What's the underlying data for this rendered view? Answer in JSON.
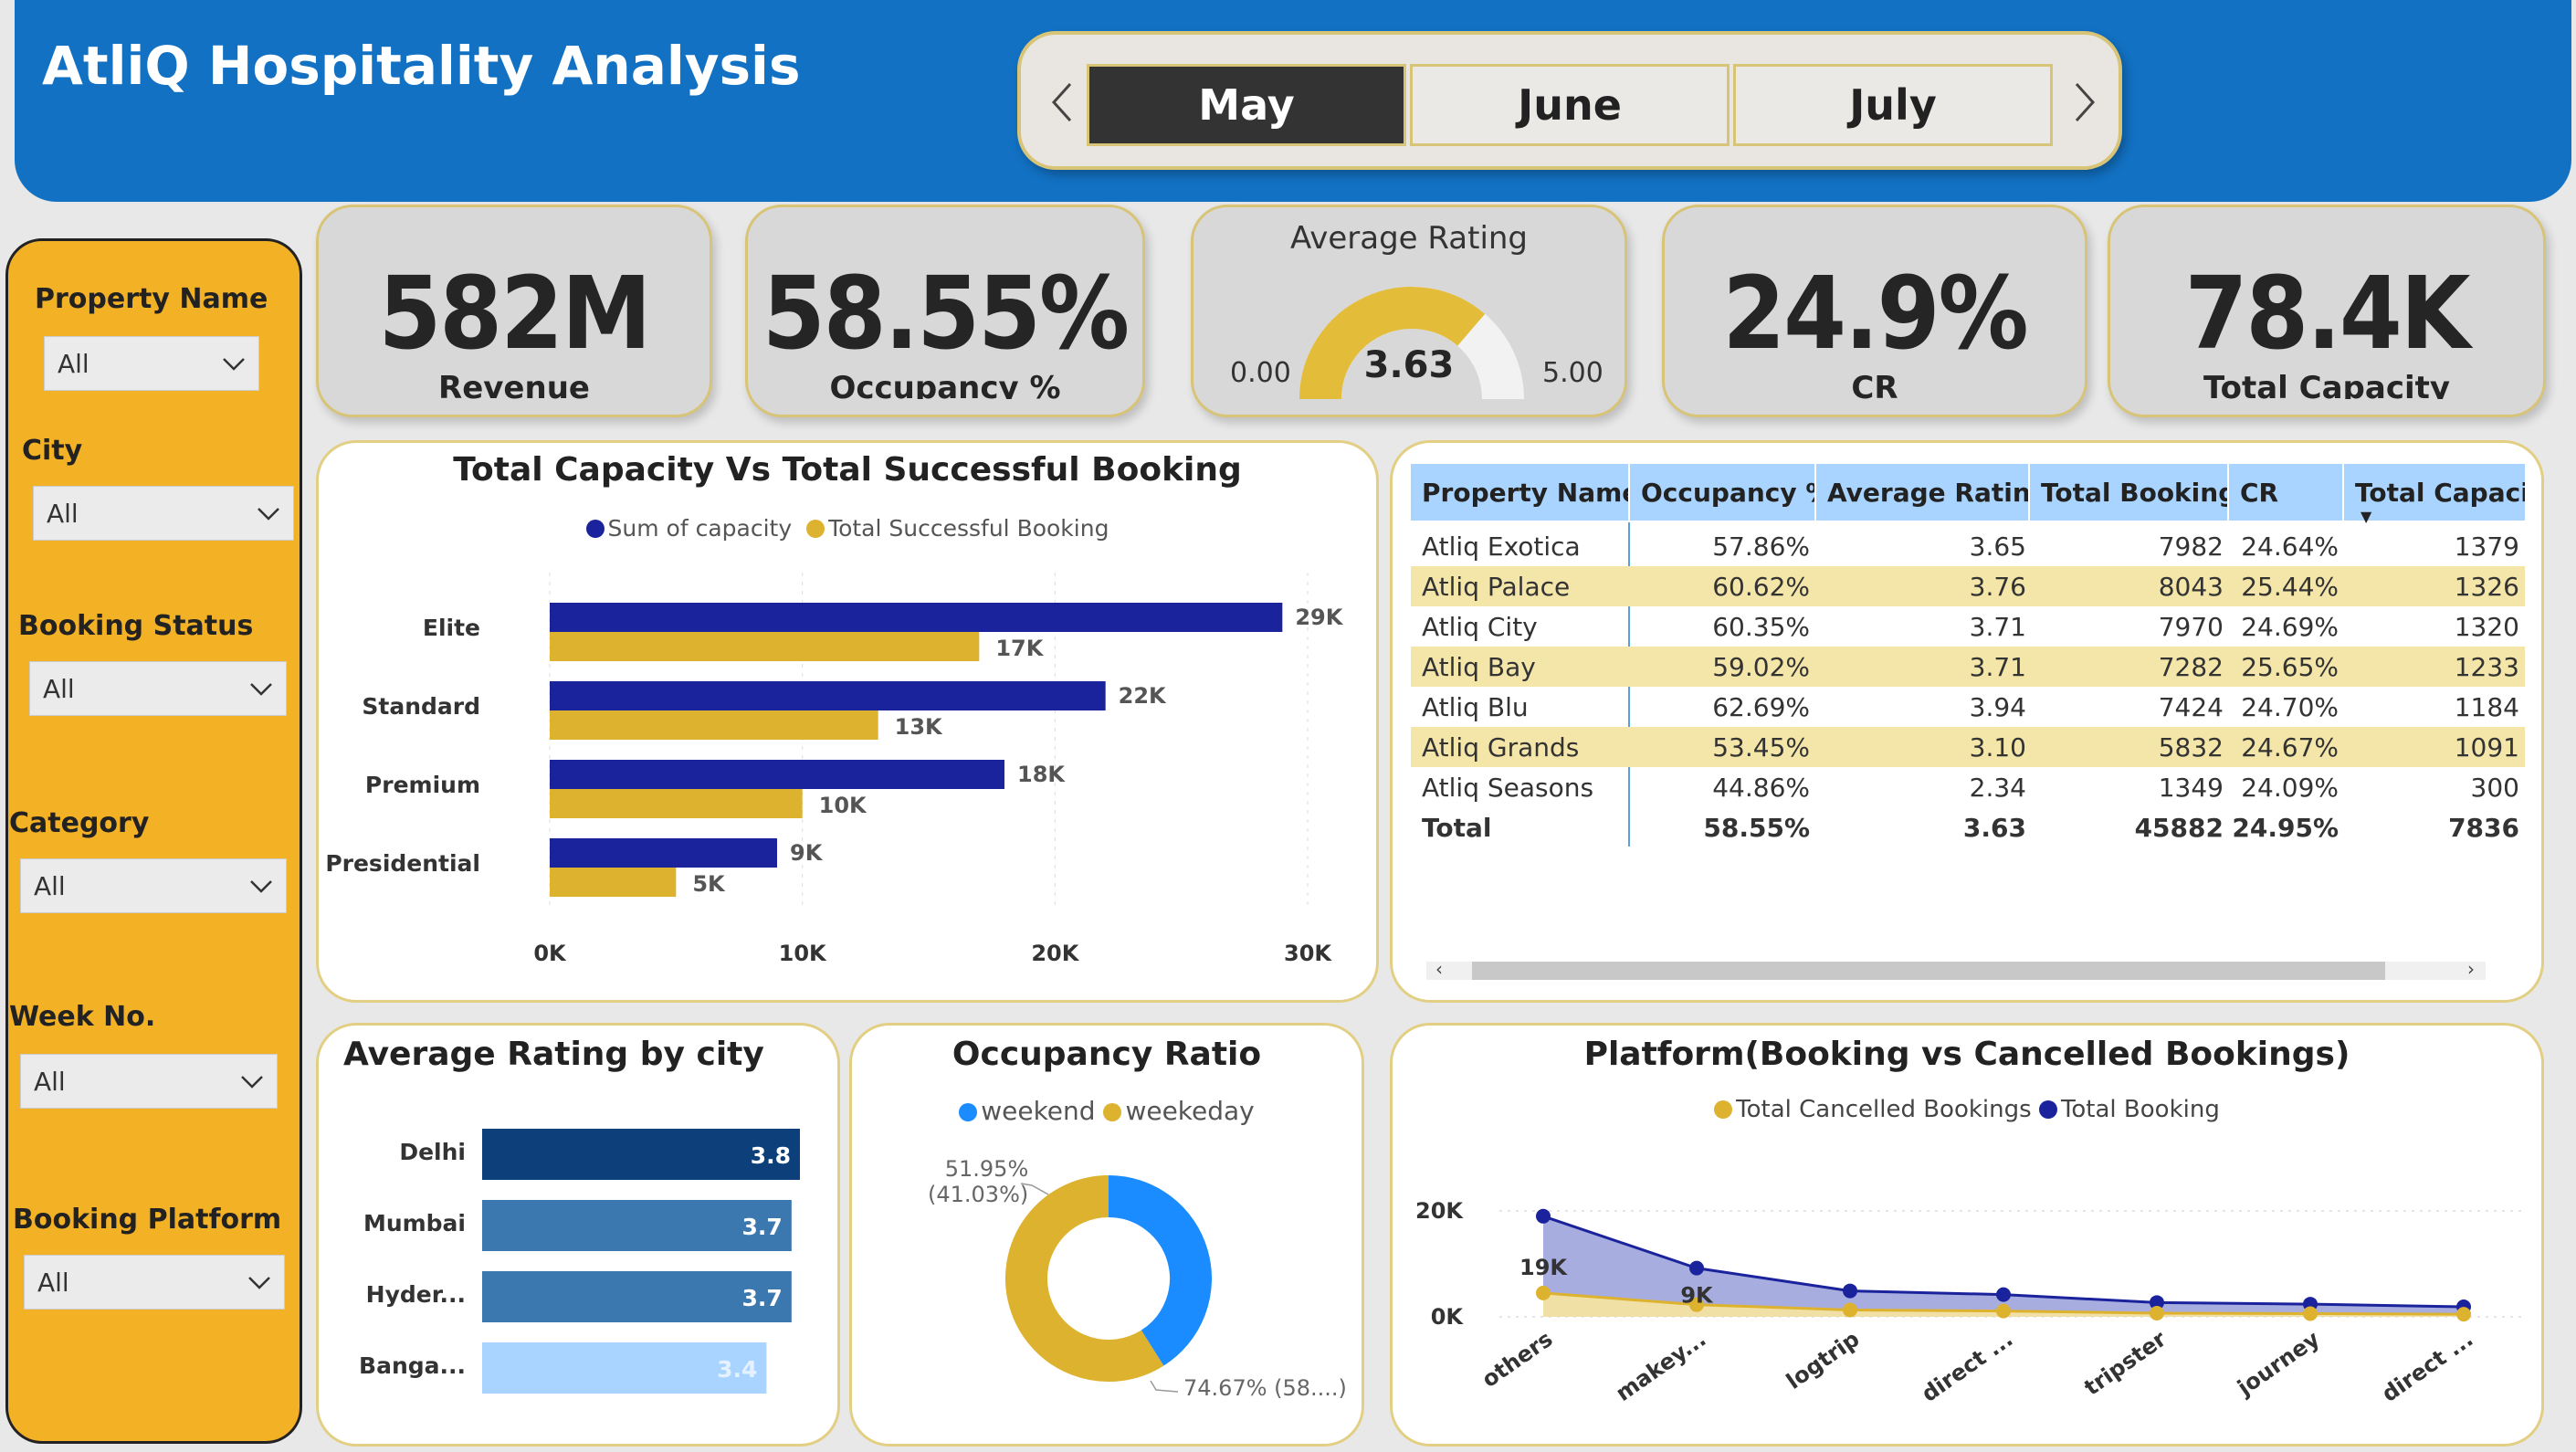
{
  "header": {
    "title": "AtliQ Hospitality Analysis",
    "months": [
      "May",
      "June",
      "July"
    ],
    "active_month": "May"
  },
  "filters": [
    {
      "label": "Property Name",
      "value": "All"
    },
    {
      "label": "City",
      "value": "All"
    },
    {
      "label": "Booking Status",
      "value": "All"
    },
    {
      "label": "Category",
      "value": "All"
    },
    {
      "label": "Week No.",
      "value": "All"
    },
    {
      "label": "Booking Platform",
      "value": "All"
    }
  ],
  "kpis": {
    "revenue": {
      "value": "582M",
      "label": "Revenue"
    },
    "occupancy": {
      "value": "58.55%",
      "label": "Occupancy %"
    },
    "rating": {
      "title": "Average Rating",
      "value": "3.63",
      "min": "0.00",
      "max": "5.00",
      "fraction": 0.726
    },
    "cr": {
      "value": "24.9%",
      "label": "CR"
    },
    "capacity": {
      "value": "78.4K",
      "label": "Total Capacity"
    }
  },
  "colors": {
    "accent_blue": "#1271c3",
    "navy": "#1a239c",
    "gold": "#ddb22e",
    "sidebar": "#f3b126",
    "table_header": "#a9d4ff",
    "table_alt": "#f4e6a9",
    "donut_blue": "#1a8cff"
  },
  "capacity_chart": {
    "title": "Total Capacity Vs Total Successful Booking",
    "legend": [
      "Sum of capacity",
      "Total Successful Booking"
    ],
    "x_ticks": [
      "0K",
      "10K",
      "20K",
      "30K"
    ]
  },
  "table": {
    "headers": [
      "Property Name",
      "Occupancy %",
      "Average Rating",
      "Total Booking",
      "CR",
      "Total Capacit"
    ],
    "rows": [
      [
        "Atliq Exotica",
        "57.86%",
        "3.65",
        "7982",
        "24.64%",
        "1379"
      ],
      [
        "Atliq Palace",
        "60.62%",
        "3.76",
        "8043",
        "25.44%",
        "1326"
      ],
      [
        "Atliq City",
        "60.35%",
        "3.71",
        "7970",
        "24.69%",
        "1320"
      ],
      [
        "Atliq Bay",
        "59.02%",
        "3.71",
        "7282",
        "25.65%",
        "1233"
      ],
      [
        "Atliq Blu",
        "62.69%",
        "3.94",
        "7424",
        "24.70%",
        "1184"
      ],
      [
        "Atliq Grands",
        "53.45%",
        "3.10",
        "5832",
        "24.67%",
        "1091"
      ],
      [
        "Atliq Seasons",
        "44.86%",
        "2.34",
        "1349",
        "24.09%",
        "300"
      ]
    ],
    "total": [
      "Total",
      "58.55%",
      "3.63",
      "45882",
      "24.95%",
      "7836"
    ]
  },
  "rating_chart": {
    "title": "Average Rating by city"
  },
  "occupancy_chart": {
    "title": "Occupancy Ratio",
    "legend": [
      "weekend",
      "weekeday"
    ],
    "label_weekend_a": "51.95%",
    "label_weekend_b": "(41.03%)",
    "label_weekday": "74.67% (58....)"
  },
  "platform_chart": {
    "title": "Platform(Booking vs Cancelled Bookings)",
    "legend": [
      "Total Cancelled Bookings",
      "Total Booking"
    ],
    "y_ticks": [
      "20K",
      "0K"
    ]
  },
  "chart_data": [
    {
      "type": "bar",
      "orientation": "horizontal",
      "title": "Total Capacity Vs Total Successful Booking",
      "categories": [
        "Elite",
        "Standard",
        "Premium",
        "Presidential"
      ],
      "series": [
        {
          "name": "Sum of capacity",
          "values": [
            29,
            22,
            18,
            9
          ],
          "labels": [
            "29K",
            "22K",
            "18K",
            "9K"
          ],
          "color": "#1a239c"
        },
        {
          "name": "Total Successful Booking",
          "values": [
            17,
            13,
            10,
            5
          ],
          "labels": [
            "17K",
            "13K",
            "10K",
            "5K"
          ],
          "color": "#ddb22e"
        }
      ],
      "xlim": [
        0,
        30
      ],
      "grid": true,
      "legend_position": "top"
    },
    {
      "type": "bar",
      "orientation": "horizontal",
      "title": "Average Rating by city",
      "categories": [
        "Delhi",
        "Mumbai",
        "Hyder...",
        "Banga..."
      ],
      "values": [
        3.8,
        3.7,
        3.7,
        3.4
      ],
      "labels": [
        "3.8",
        "3.7",
        "3.7",
        "3.4"
      ],
      "colors": [
        "#0d3f7a",
        "#3c78b0",
        "#3c78b0",
        "#a9d4ff"
      ],
      "xlim": [
        0,
        3.8
      ]
    },
    {
      "type": "pie",
      "title": "Occupancy Ratio",
      "categories": [
        "weekend",
        "weekeday"
      ],
      "values": [
        41.03,
        58.97
      ],
      "colors": [
        "#1a8cff",
        "#ddb22e"
      ],
      "legend_position": "top"
    },
    {
      "type": "area",
      "title": "Platform(Booking vs Cancelled Bookings)",
      "categories": [
        "others",
        "makey...",
        "logtrip",
        "direct ...",
        "tripster",
        "journey",
        "direct ..."
      ],
      "series": [
        {
          "name": "Total Booking",
          "values": [
            19,
            9.2,
            4.9,
            4.2,
            2.7,
            2.4,
            1.9
          ],
          "color": "#1a239c"
        },
        {
          "name": "Total Cancelled Bookings",
          "values": [
            4.5,
            2.3,
            1.3,
            1.1,
            0.7,
            0.6,
            0.5
          ],
          "color": "#ddb22e"
        }
      ],
      "data_labels": {
        "others": "19K",
        "makey...": "9K"
      },
      "y_ticks": [
        "20K",
        "0K"
      ],
      "ylim": [
        0,
        25
      ],
      "legend_position": "top"
    }
  ]
}
